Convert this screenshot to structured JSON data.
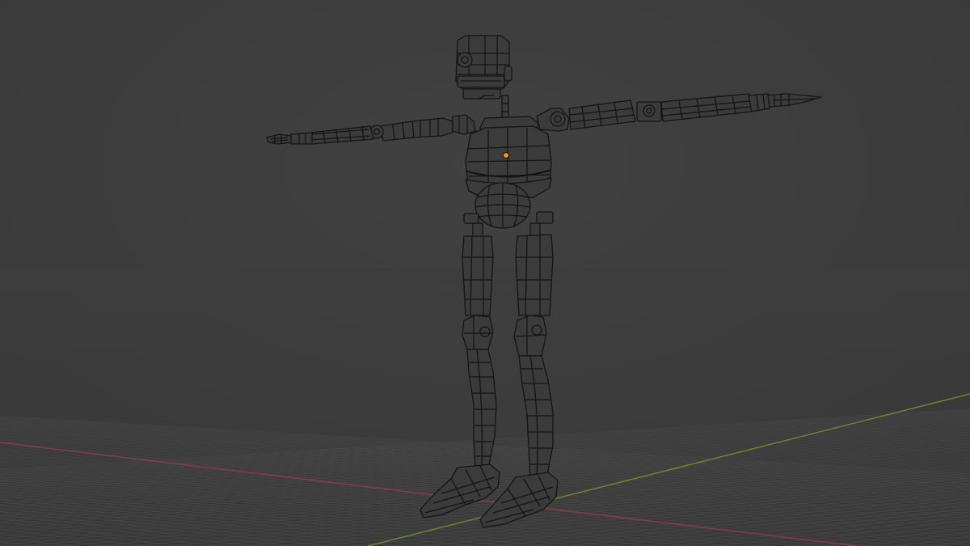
{
  "viewport": {
    "mode": "wireframe",
    "background_color": "#3d3d3d",
    "grid_color": "#4a4a4a",
    "x_axis_color": "#8e3a46",
    "y_axis_color": "#6f8a2d",
    "wire_color": "#141414",
    "mesh_fill_color": "#3b3b3b",
    "origin_color": "#f0a020"
  },
  "object": {
    "name_icon": "robot-mesh",
    "pose": "t-pose"
  }
}
